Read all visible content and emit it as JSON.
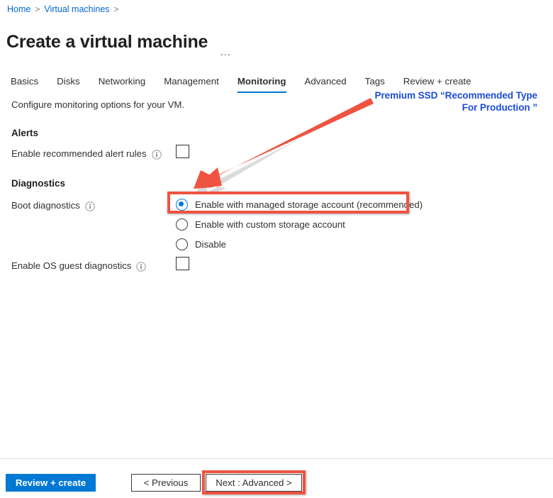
{
  "breadcrumb": {
    "items": [
      {
        "label": "Home"
      },
      {
        "label": "Virtual machines"
      }
    ],
    "separator": ">"
  },
  "header": {
    "title": "Create a virtual machine",
    "more_actions": "···"
  },
  "tabs": [
    {
      "label": "Basics",
      "active": false
    },
    {
      "label": "Disks",
      "active": false
    },
    {
      "label": "Networking",
      "active": false
    },
    {
      "label": "Management",
      "active": false
    },
    {
      "label": "Monitoring",
      "active": true
    },
    {
      "label": "Advanced",
      "active": false
    },
    {
      "label": "Tags",
      "active": false
    },
    {
      "label": "Review + create",
      "active": false
    }
  ],
  "main": {
    "intro": "Configure monitoring options for your VM.",
    "alerts": {
      "heading": "Alerts",
      "enable_recommended_alert_rules": {
        "label": "Enable recommended alert rules",
        "checked": false
      }
    },
    "diagnostics": {
      "heading": "Diagnostics",
      "boot_diagnostics": {
        "label": "Boot diagnostics",
        "options": [
          {
            "label": "Enable with managed storage account (recommended)",
            "selected": true
          },
          {
            "label": "Enable with custom storage account",
            "selected": false
          },
          {
            "label": "Disable",
            "selected": false
          }
        ]
      },
      "os_guest_diagnostics": {
        "label": "Enable OS guest diagnostics",
        "checked": false
      }
    }
  },
  "annotations": {
    "note_line1": "Premium SSD “Recommended Type",
    "note_line2": "For Production ”",
    "note_color": "#1d4ed8",
    "highlight_color": "#ef5440",
    "arrow_color": "#ef5440"
  },
  "footer": {
    "review_create": "Review + create",
    "previous": "< Previous",
    "next": "Next : Advanced >",
    "primary_color": "#0078d4"
  }
}
